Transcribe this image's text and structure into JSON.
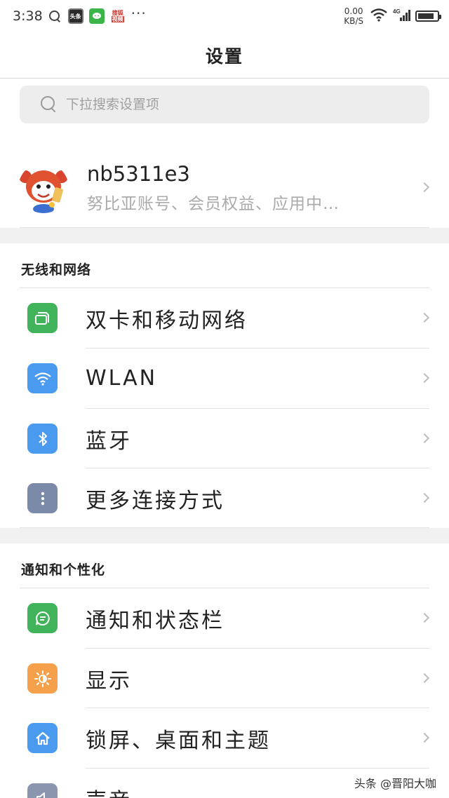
{
  "status_bar": {
    "time": "3:38",
    "apps": [
      "头条",
      "",
      "搜狐",
      "视频"
    ],
    "more": "···",
    "speed_top": "0.00",
    "speed_bottom": "KB/S",
    "network": "4G"
  },
  "header": {
    "title": "设置"
  },
  "search": {
    "placeholder": "下拉搜索设置项"
  },
  "account": {
    "name": "nb5311e3",
    "subtitle": "努比亚账号、会员权益、应用中…"
  },
  "sections": [
    {
      "title": "无线和网络",
      "items": [
        {
          "label": "双卡和移动网络",
          "icon": "sim-card-icon",
          "color": "#41b35a"
        },
        {
          "label": "WLAN",
          "icon": "wifi-icon",
          "color": "#4a9af0"
        },
        {
          "label": "蓝牙",
          "icon": "bluetooth-icon",
          "color": "#4a9af0"
        },
        {
          "label": "更多连接方式",
          "icon": "more-vertical-icon",
          "color": "#7a8aa8"
        }
      ]
    },
    {
      "title": "通知和个性化",
      "items": [
        {
          "label": "通知和状态栏",
          "icon": "chat-bubble-icon",
          "color": "#41b35a"
        },
        {
          "label": "显示",
          "icon": "brightness-icon",
          "color": "#f5a04b"
        },
        {
          "label": "锁屏、桌面和主题",
          "icon": "home-icon",
          "color": "#4a9af0"
        },
        {
          "label": "声音",
          "icon": "speaker-icon",
          "color": "#8a96ad"
        }
      ]
    }
  ],
  "watermark": "头条 @晋阳大咖"
}
